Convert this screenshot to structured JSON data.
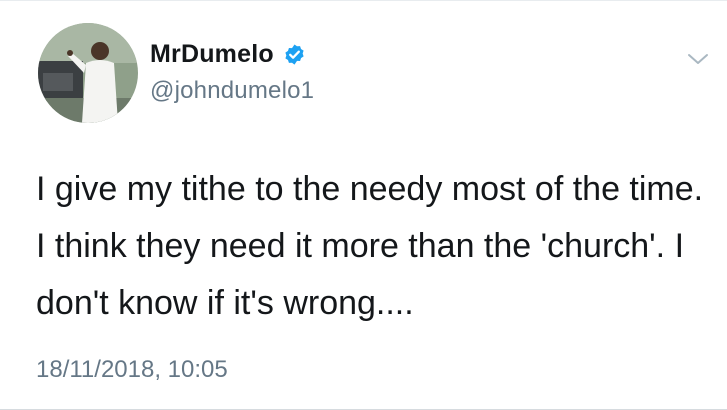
{
  "tweet": {
    "display_name": "MrDumelo",
    "handle": "@johndumelo1",
    "text": "I give my tithe to the needy most of the time. I think they need it more than the 'church'. I don't know if it's wrong....",
    "timestamp": "18/11/2018, 10:05"
  },
  "icons": {
    "verified": "verified-badge-icon",
    "menu": "chevron-down-icon",
    "avatar": "profile-photo"
  },
  "colors": {
    "verified_blue": "#1da1f2",
    "name_text": "#14171a",
    "secondary_text": "#657786",
    "caret": "#aab8c2"
  }
}
